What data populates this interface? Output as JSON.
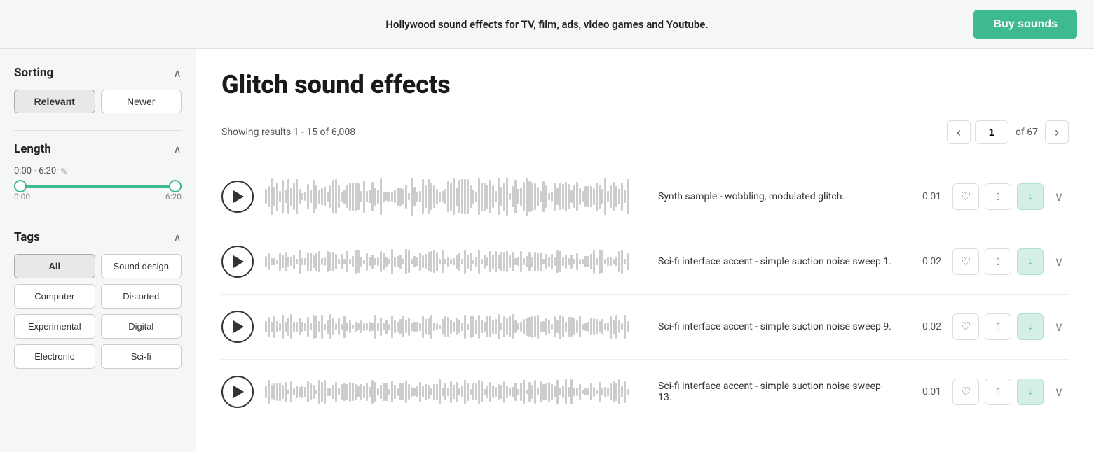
{
  "header": {
    "tagline": "Hollywood sound effects for TV, film, ads, video games and Youtube.",
    "buy_label": "Buy sounds"
  },
  "sidebar": {
    "sorting": {
      "title": "Sorting",
      "options": [
        {
          "id": "relevant",
          "label": "Relevant",
          "active": true
        },
        {
          "id": "newer",
          "label": "Newer",
          "active": false
        }
      ]
    },
    "length": {
      "title": "Length",
      "range_text": "0:00 - 6:20",
      "min_label": "0:00",
      "max_label": "6:20"
    },
    "tags": {
      "title": "Tags",
      "items": [
        {
          "id": "all",
          "label": "All",
          "active": true
        },
        {
          "id": "sound-design",
          "label": "Sound design",
          "active": false
        },
        {
          "id": "computer",
          "label": "Computer",
          "active": false
        },
        {
          "id": "distorted",
          "label": "Distorted",
          "active": false
        },
        {
          "id": "experimental",
          "label": "Experimental",
          "active": false
        },
        {
          "id": "digital",
          "label": "Digital",
          "active": false
        },
        {
          "id": "electronic",
          "label": "Electronic",
          "active": false
        },
        {
          "id": "sci-fi",
          "label": "Sci-fi",
          "active": false
        }
      ]
    }
  },
  "main": {
    "title": "Glitch sound effects",
    "results_text": "Showing results 1 - 15 of 6,008",
    "pagination": {
      "current_page": "1",
      "total_pages": "67",
      "of_label": "of 67",
      "prev_icon": "‹",
      "next_icon": "›"
    },
    "sounds": [
      {
        "id": 1,
        "description": "Synth sample - wobbling, modulated glitch.",
        "duration": "0:01",
        "has_waveform": true
      },
      {
        "id": 2,
        "description": "Sci-fi interface accent - simple suction noise sweep 1.",
        "duration": "0:02",
        "has_waveform": false
      },
      {
        "id": 3,
        "description": "Sci-fi interface accent - simple suction noise sweep 9.",
        "duration": "0:02",
        "has_waveform": false
      },
      {
        "id": 4,
        "description": "Sci-fi interface accent - simple suction noise sweep 13.",
        "duration": "0:01",
        "has_waveform": false
      }
    ]
  }
}
